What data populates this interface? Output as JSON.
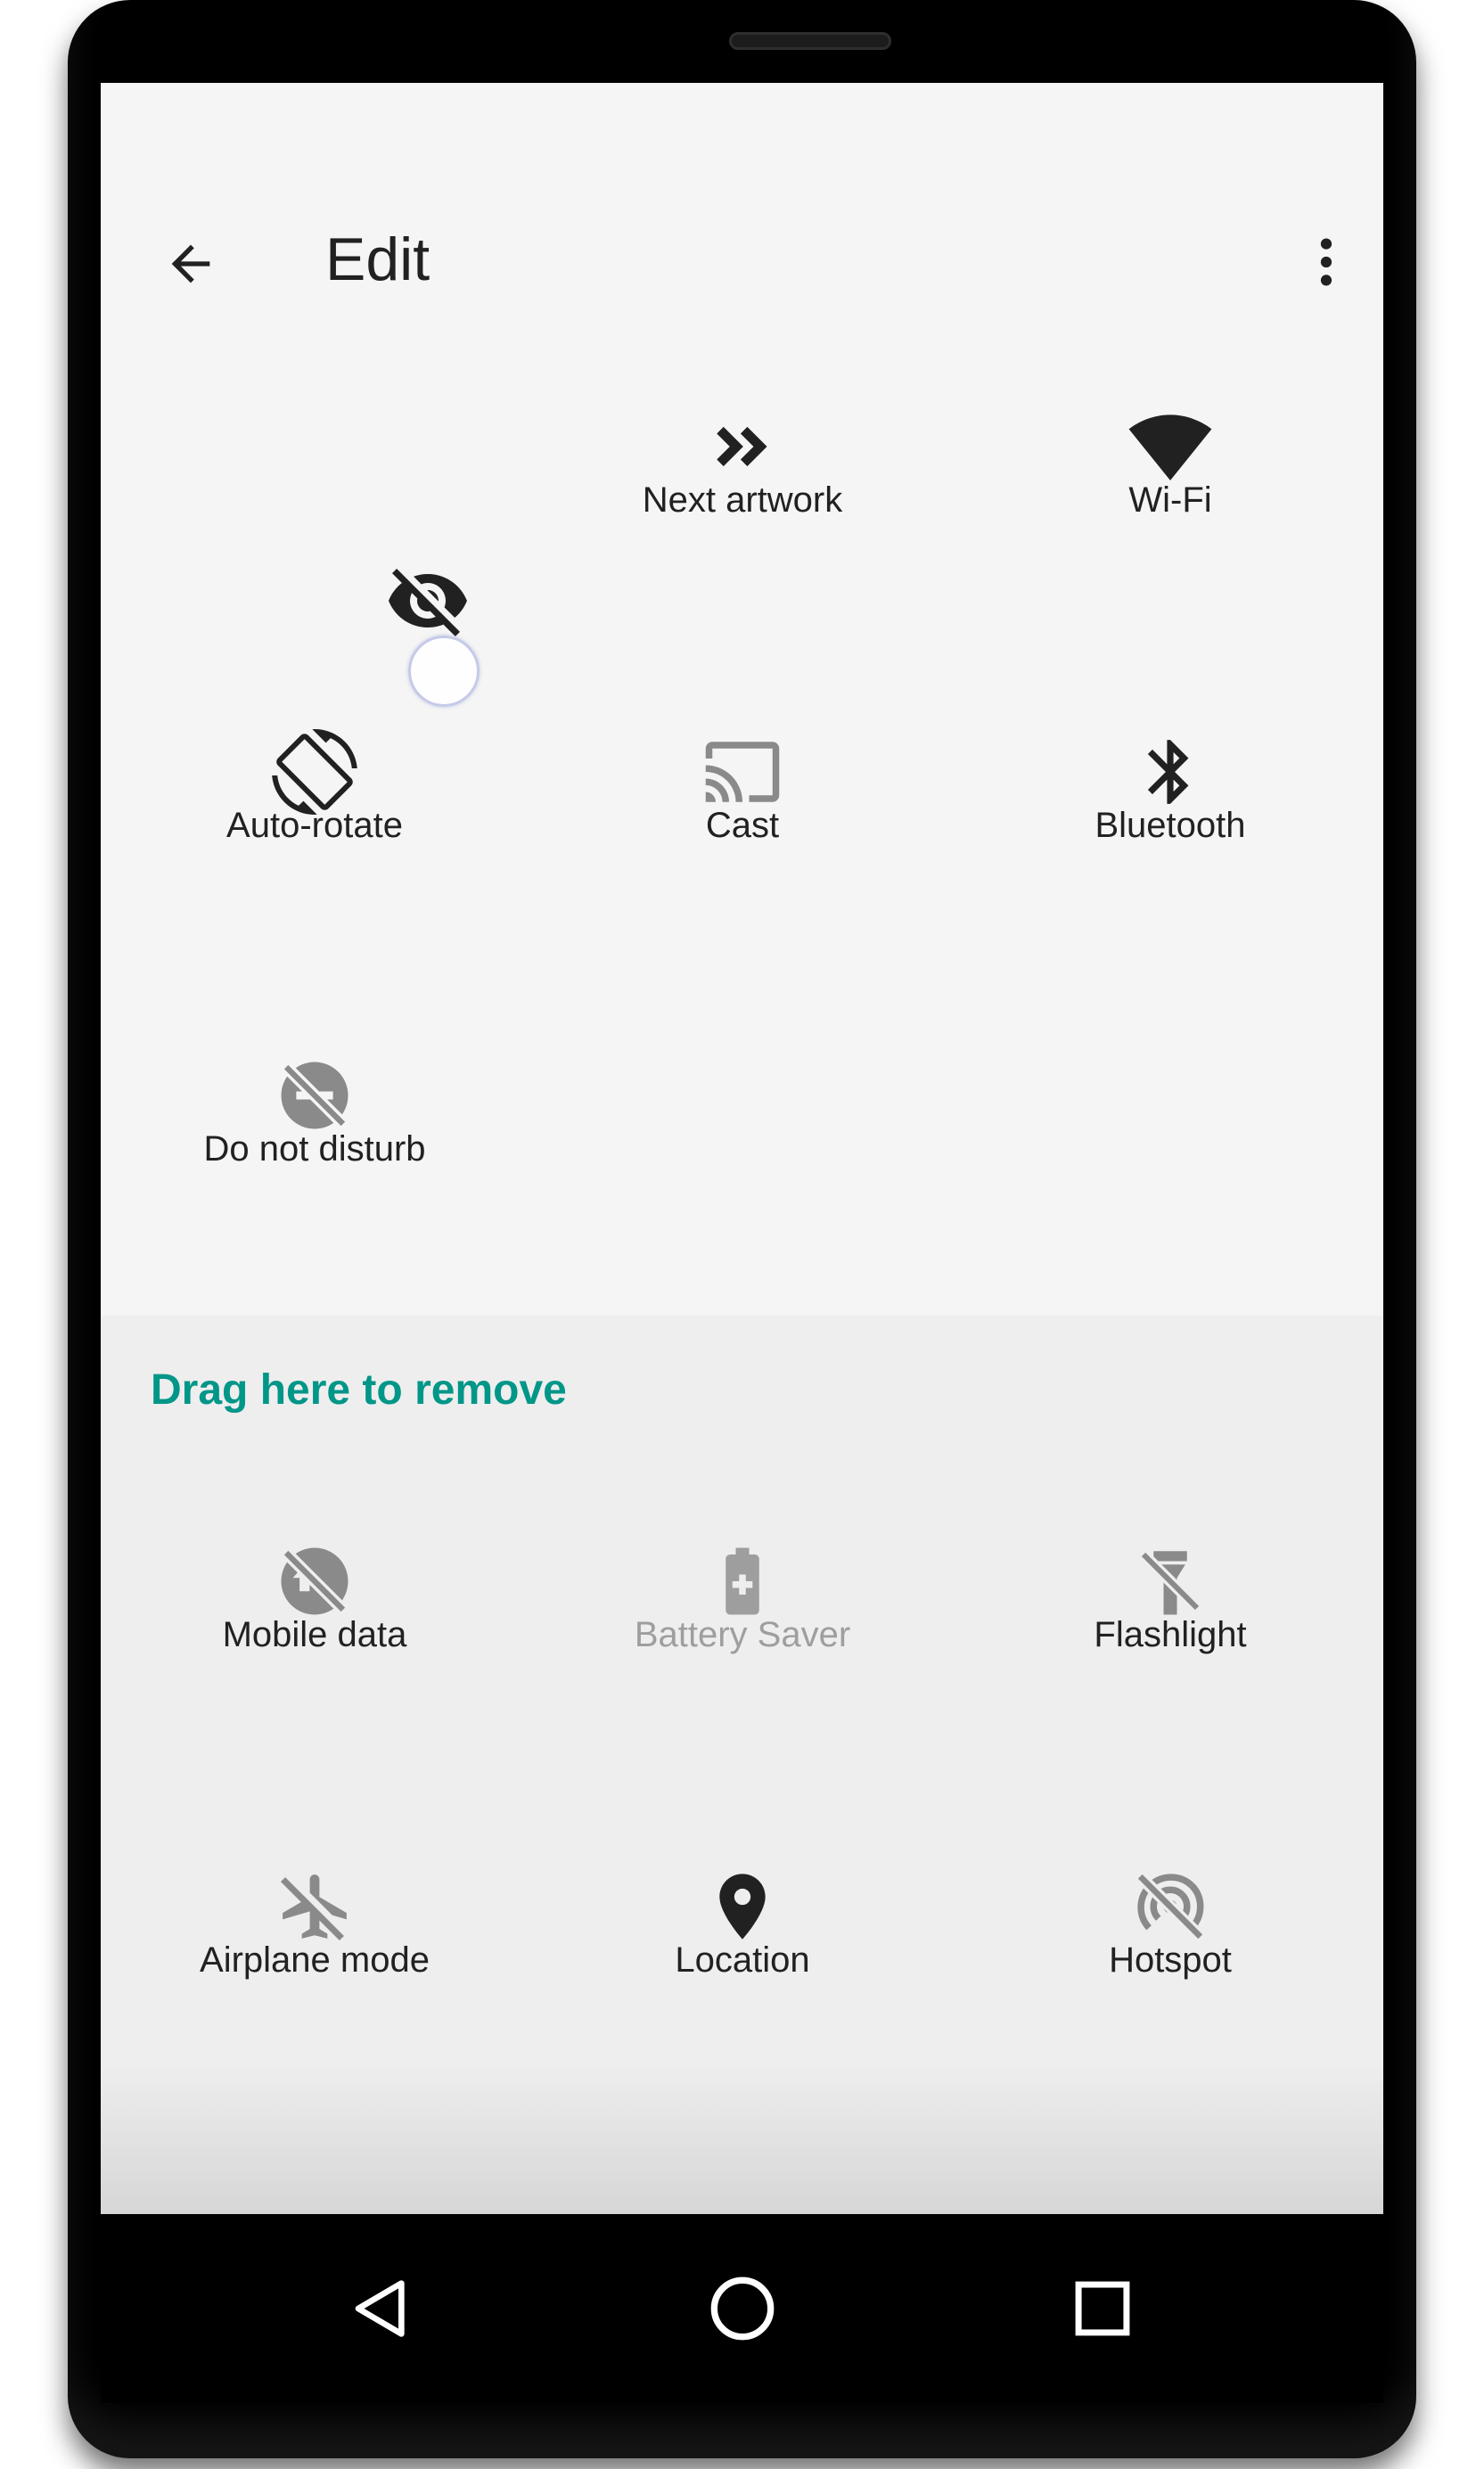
{
  "toolbar": {
    "back_icon": "arrow-back-icon",
    "title": "Edit",
    "overflow_icon": "more-vert-icon"
  },
  "active_tiles": [
    {
      "label": "",
      "icon": "visibility-off-icon"
    },
    {
      "label": "Next artwork",
      "icon": "double-chevron-right-icon"
    },
    {
      "label": "Wi-Fi",
      "icon": "wifi-icon"
    },
    {
      "label": "Auto-rotate",
      "icon": "screen-rotation-icon"
    },
    {
      "label": "Cast",
      "icon": "cast-icon"
    },
    {
      "label": "Bluetooth",
      "icon": "bluetooth-icon"
    },
    {
      "label": "Do not disturb",
      "icon": "do-not-disturb-off-icon"
    }
  ],
  "remove_section": {
    "title": "Drag here to remove",
    "tiles": [
      {
        "label": "Mobile data",
        "icon": "mobile-data-off-icon"
      },
      {
        "label": "Battery Saver",
        "icon": "battery-saver-icon",
        "disabled": true
      },
      {
        "label": "Flashlight",
        "icon": "flashlight-off-icon"
      },
      {
        "label": "Airplane mode",
        "icon": "airplane-off-icon"
      },
      {
        "label": "Location",
        "icon": "location-pin-icon"
      },
      {
        "label": "Hotspot",
        "icon": "hotspot-off-icon"
      }
    ]
  },
  "navbar": {
    "back": "nav-back-icon",
    "home": "nav-home-icon",
    "recents": "nav-recents-icon"
  },
  "colors": {
    "accent": "#009688",
    "screen_bg": "#f5f5f5",
    "remove_bg": "#eeeeee",
    "text_primary": "#212121",
    "text_disabled": "#9e9e9e",
    "icon_inactive": "#8a8a8a"
  }
}
